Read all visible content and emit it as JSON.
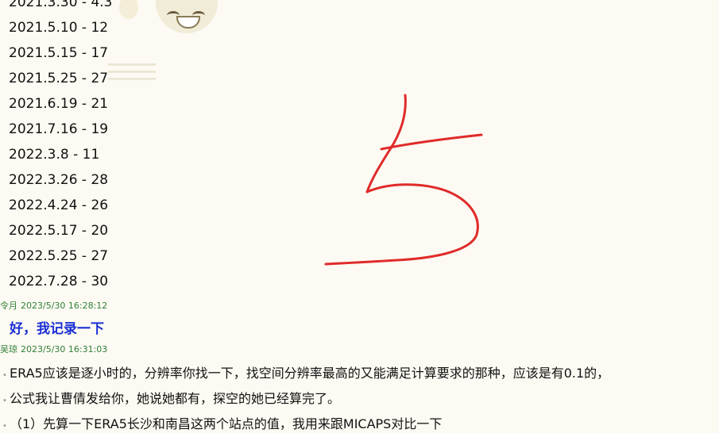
{
  "date_ranges": [
    "2021.3.30 - 4.3",
    "2021.5.10 - 12",
    "2021.5.15 - 17",
    "2021.5.25 - 27",
    "2021.6.19 - 21",
    "2021.7.16 - 19",
    "2022.3.8 - 11",
    "2022.3.26 - 28",
    "2022.4.24 - 26",
    "2022.5.17 - 20",
    "2022.5.25 - 27",
    "2022.7.28 - 30"
  ],
  "messages": [
    {
      "sender": "令月",
      "timestamp": "2023/5/30 16:28:12",
      "text": "好，我记录一下"
    },
    {
      "sender": "吴琼",
      "timestamp": "2023/5/30 16:31:03",
      "lines": [
        "ERA5应该是逐小时的，分辨率你找一下，找空间分辨率最高的又能满足计算要求的那种，应该是有0.1的，",
        "公式我让曹倩发给你，她说她都有，探空的她已经算完了。",
        "（1）先算一下ERA5长沙和南昌这两个站点的值，我用来跟MICAPS对比一下"
      ]
    }
  ],
  "colors": {
    "sender_header": "#2f7f38",
    "highlight_text": "#1a2fd6",
    "annotation_stroke": "#e02a2a",
    "background": "#fcfaf2"
  }
}
